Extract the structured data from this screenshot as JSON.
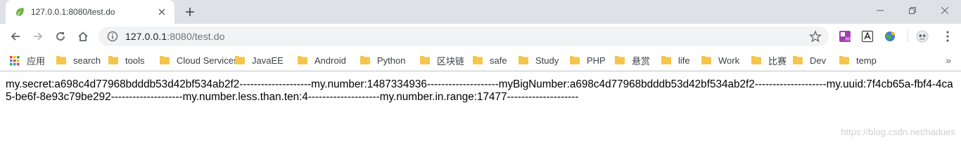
{
  "tab": {
    "title": "127.0.0.1:8080/test.do"
  },
  "omnibox": {
    "host": "127.0.0.1",
    "rest": ":8080/test.do"
  },
  "bookmarks": [
    {
      "label": "应用",
      "icon": "apps-grid-icon"
    },
    {
      "label": "search",
      "icon": "folder-icon"
    },
    {
      "label": "tools",
      "icon": "folder-icon"
    },
    {
      "label": "Cloud Services",
      "icon": "folder-icon"
    },
    {
      "label": "JavaEE",
      "icon": "folder-icon"
    },
    {
      "label": "Android",
      "icon": "folder-icon"
    },
    {
      "label": "Python",
      "icon": "folder-icon"
    },
    {
      "label": "区块链",
      "icon": "folder-icon"
    },
    {
      "label": "safe",
      "icon": "folder-icon"
    },
    {
      "label": "Study",
      "icon": "folder-icon"
    },
    {
      "label": "PHP",
      "icon": "folder-icon"
    },
    {
      "label": "悬赏",
      "icon": "folder-icon"
    },
    {
      "label": "life",
      "icon": "folder-icon"
    },
    {
      "label": "Work",
      "icon": "folder-icon"
    },
    {
      "label": "比赛",
      "icon": "folder-icon"
    },
    {
      "label": "Dev",
      "icon": "folder-icon"
    },
    {
      "label": "temp",
      "icon": "folder-icon"
    }
  ],
  "bookmarks_more": "»",
  "content": {
    "text": "my.secret:a698c4d77968bdddb53d42bf534ab2f2--------------------my.number:1487334936--------------------myBigNumber:a698c4d77968bdddb53d42bf534ab2f2--------------------my.uuid:7f4cb65a-fbf4-4ca5-be6f-8e93c79be292--------------------my.number.less.than.ten:4--------------------my.number.in.range:17477--------------------",
    "watermark": "https://blog.csdn.net/hadues"
  },
  "colors": {
    "folder": "#f5c54a",
    "tabstrip": "#dee1e6",
    "omnibox": "#f1f3f4",
    "favicon": "#6db33f"
  }
}
